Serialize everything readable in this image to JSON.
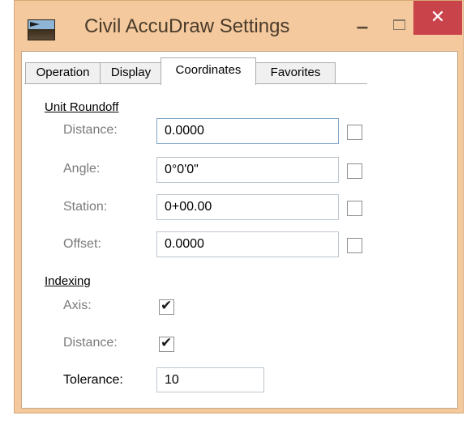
{
  "window": {
    "title": "Civil AccuDraw Settings",
    "minimize_glyph": "–",
    "close_glyph": "✕"
  },
  "tabs": [
    {
      "label": "Operation",
      "active": false
    },
    {
      "label": "Display",
      "active": false
    },
    {
      "label": "Coordinates",
      "active": true
    },
    {
      "label": "Favorites",
      "active": false
    }
  ],
  "unit_roundoff": {
    "heading": "Unit Roundoff",
    "distance": {
      "label": "Distance:",
      "value": "0.0000",
      "checked": false
    },
    "angle": {
      "label": "Angle:",
      "value": "0°0'0\"",
      "checked": false
    },
    "station": {
      "label": "Station:",
      "value": "0+00.00",
      "checked": false
    },
    "offset": {
      "label": "Offset:",
      "value": "0.0000",
      "checked": false
    }
  },
  "indexing": {
    "heading": "Indexing",
    "axis": {
      "label": "Axis:",
      "checked": true
    },
    "distance": {
      "label": "Distance:",
      "checked": true
    },
    "tolerance": {
      "label": "Tolerance:",
      "value": "10"
    }
  },
  "colors": {
    "title_bar": "#f3c99d",
    "close_button": "#c9434b"
  }
}
